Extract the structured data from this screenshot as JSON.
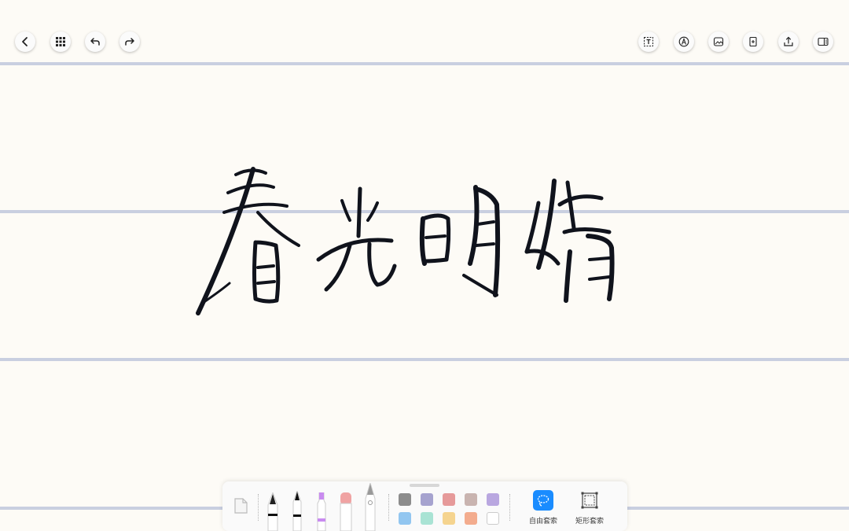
{
  "top_bar": {
    "left_icons": [
      "back-icon",
      "grid-icon",
      "undo-icon",
      "redo-icon"
    ],
    "right_icons": [
      "text-box-icon",
      "pen-circle-icon",
      "image-icon",
      "add-page-icon",
      "share-icon",
      "sidebar-icon"
    ]
  },
  "canvas": {
    "handwritten_text": "春光明媚",
    "ruled_line_color": "#c9cfe0",
    "paper_color": "#fdfbf6"
  },
  "toolbar": {
    "tools": [
      "eraser-page-icon",
      "fountain-pen-icon",
      "marker-icon",
      "highlighter-icon",
      "eraser-icon",
      "pencil-icon"
    ],
    "colors_row1": [
      "#8c8c8c",
      "#a6a3cf",
      "#e69a9a",
      "#c9b4b0",
      "#b9a7e0"
    ],
    "colors_row2": [
      "#92c6f0",
      "#a9e3d4",
      "#f5d48f",
      "#f3ac8e",
      "#ffffff"
    ],
    "lasso_free_label": "自由套索",
    "lasso_rect_label": "矩形套索",
    "accent_color": "#1a8cff"
  }
}
